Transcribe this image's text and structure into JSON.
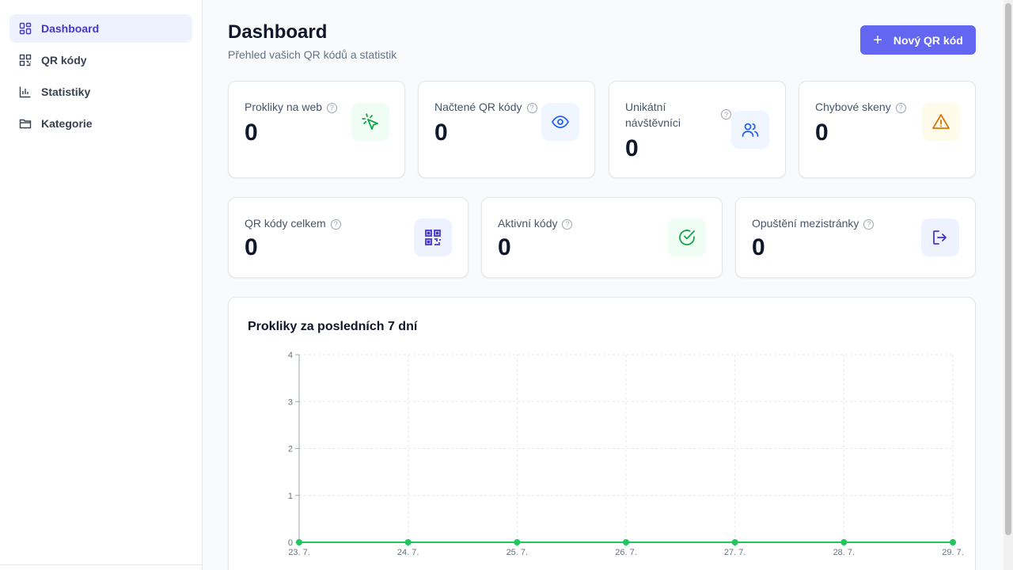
{
  "sidebar": {
    "items": [
      {
        "label": "Dashboard",
        "icon": "dashboard-grid-icon",
        "active": true
      },
      {
        "label": "QR kódy",
        "icon": "qr-code-icon",
        "active": false
      },
      {
        "label": "Statistiky",
        "icon": "bar-chart-icon",
        "active": false
      },
      {
        "label": "Kategorie",
        "icon": "folder-icon",
        "active": false
      }
    ]
  },
  "header": {
    "title": "Dashboard",
    "subtitle": "Přehled vašich QR kódů a statistik",
    "new_button": "Nový QR kód"
  },
  "stats": {
    "row1": [
      {
        "label": "Prokliky na web",
        "value": "0",
        "icon": "cursor-click-icon",
        "color": "#16a34a",
        "bg": "#f0fdf4"
      },
      {
        "label": "Načtené QR kódy",
        "value": "0",
        "icon": "eye-icon",
        "color": "#2563eb",
        "bg": "#eff6ff"
      },
      {
        "label": "Unikátní návštěvníci",
        "value": "0",
        "icon": "users-icon",
        "color": "#2563eb",
        "bg": "#eff6ff"
      },
      {
        "label": "Chybové skeny",
        "value": "0",
        "icon": "warning-triangle-icon",
        "color": "#d97706",
        "bg": "#fffbeb"
      }
    ],
    "row2": [
      {
        "label": "QR kódy celkem",
        "value": "0",
        "icon": "qr-code-icon",
        "color": "#4338ca",
        "bg": "#eef2ff"
      },
      {
        "label": "Aktivní kódy",
        "value": "0",
        "icon": "check-circle-icon",
        "color": "#16a34a",
        "bg": "#f0fdf4"
      },
      {
        "label": "Opuštění mezistránky",
        "value": "0",
        "icon": "exit-icon",
        "color": "#4338ca",
        "bg": "#eef2ff"
      }
    ],
    "help_glyph": "?"
  },
  "chart_data": {
    "type": "line",
    "title": "Prokliky za posledních 7 dní",
    "categories": [
      "23. 7.",
      "24. 7.",
      "25. 7.",
      "26. 7.",
      "27. 7.",
      "28. 7.",
      "29. 7."
    ],
    "series": [
      {
        "values": [
          0,
          0,
          0,
          0,
          0,
          0,
          0
        ],
        "color": "#22c55e"
      }
    ],
    "yticks": [
      0,
      1,
      2,
      3,
      4
    ],
    "ylim": [
      0,
      4
    ],
    "grid": true,
    "xlabel": "",
    "ylabel": ""
  }
}
